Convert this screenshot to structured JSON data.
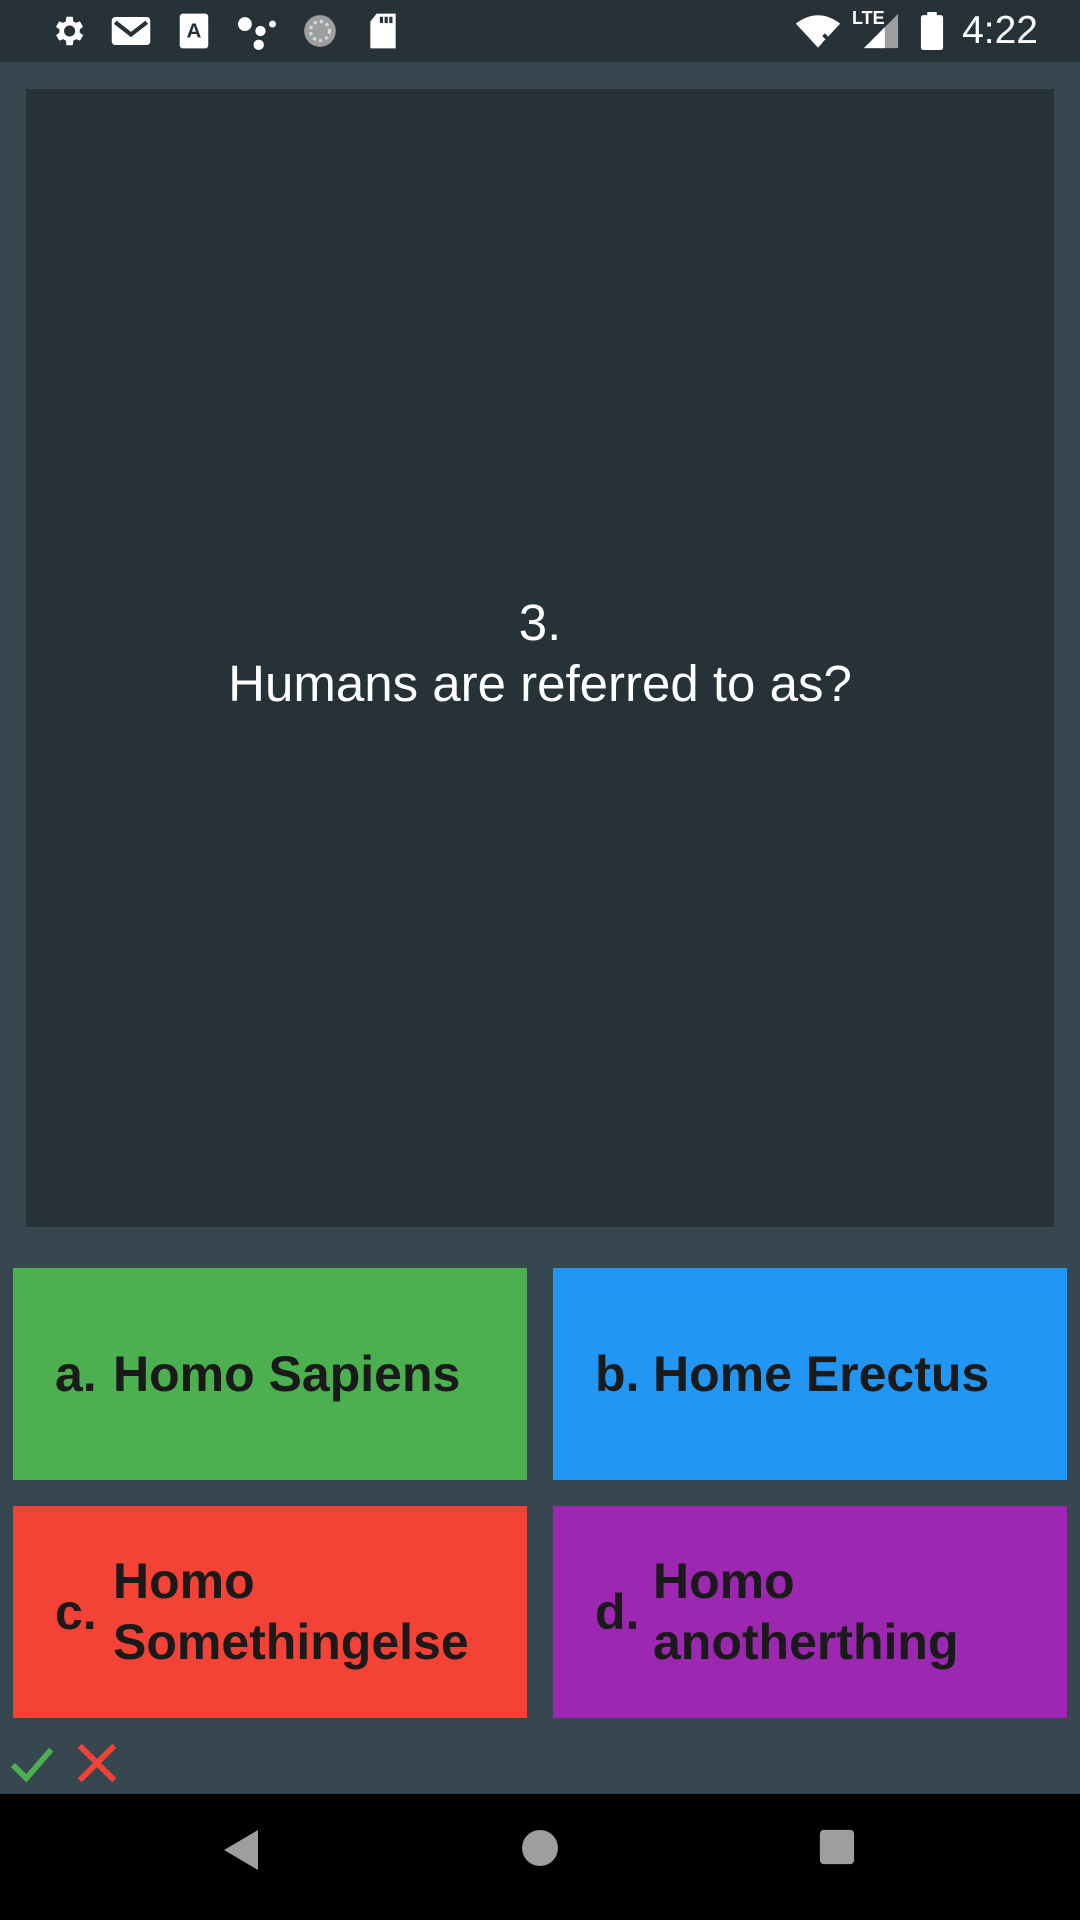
{
  "status_bar": {
    "time": "4:22",
    "network_label": "LTE",
    "left_icons": [
      "settings-icon",
      "gmail-icon",
      "font-app-icon",
      "assistant-dots-icon",
      "loading-spinner-icon",
      "sd-card-icon"
    ],
    "right_icons": [
      "wifi-icon",
      "lte-signal-icon",
      "battery-icon"
    ]
  },
  "question": {
    "number": "3.",
    "text": "Humans are referred to as?"
  },
  "answers": [
    {
      "letter": "a.",
      "text": "Homo Sapiens",
      "color": "#4caf50"
    },
    {
      "letter": "b.",
      "text": "Home Erectus",
      "color": "#2196f3"
    },
    {
      "letter": "c.",
      "text": "Homo Somethingelse",
      "color": "#f44336"
    },
    {
      "letter": "d.",
      "text": "Homo anotherthing",
      "color": "#9c27b0"
    }
  ],
  "score": {
    "correct_icon": "check-icon",
    "wrong_icon": "cross-icon",
    "correct_color": "#4caf50",
    "wrong_color": "#f44336"
  },
  "nav_bar": {
    "buttons": [
      "back-icon",
      "home-icon",
      "recents-icon"
    ]
  }
}
